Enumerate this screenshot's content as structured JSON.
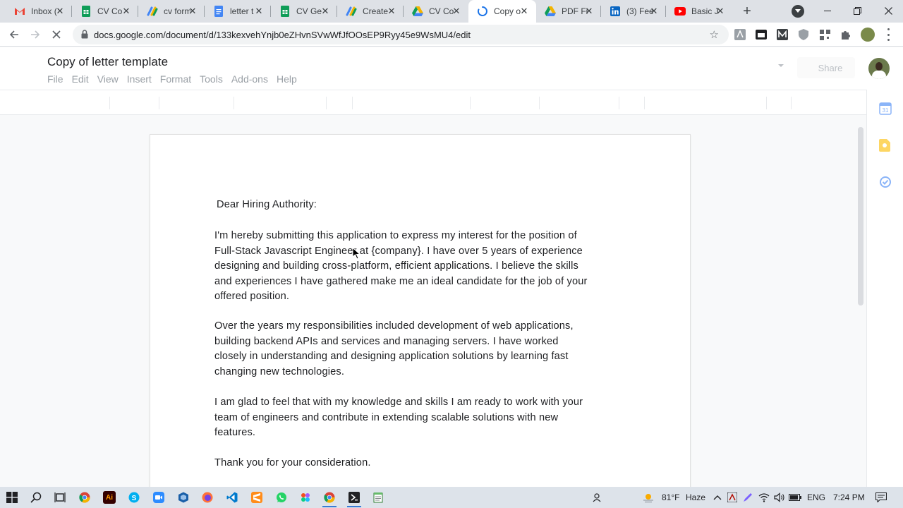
{
  "browser": {
    "tabs": [
      {
        "title": "Inbox (",
        "icon": "gmail-icon",
        "color": "#ea4335"
      },
      {
        "title": "CV Co",
        "icon": "sheets-icon",
        "color": "#0f9d58"
      },
      {
        "title": "cv form",
        "icon": "apps-script-icon",
        "color": "#f4b400"
      },
      {
        "title": "letter t",
        "icon": "docs-icon",
        "color": "#4285f4"
      },
      {
        "title": "CV Ge",
        "icon": "sheets-icon",
        "color": "#0f9d58"
      },
      {
        "title": "Create",
        "icon": "apps-script-icon",
        "color": "#f4b400"
      },
      {
        "title": "CV Co",
        "icon": "drive-icon",
        "color": "#1fa463"
      },
      {
        "title": "Copy o",
        "icon": "loading-spinner-icon",
        "color": "#1a73e8",
        "active": true
      },
      {
        "title": "PDF Fil",
        "icon": "drive-icon",
        "color": "#1fa463"
      },
      {
        "title": "(3) Fee",
        "icon": "linkedin-icon",
        "color": "#0a66c2"
      },
      {
        "title": "Basic J",
        "icon": "youtube-icon",
        "color": "#ff0000"
      }
    ],
    "url": "docs.google.com/document/d/133kexvehYnjb0eZHvnSVwWfJfOOsEP9Ryy45e9WsMU4/edit"
  },
  "doc": {
    "title": "Copy of letter template",
    "menu": [
      "File",
      "Edit",
      "View",
      "Insert",
      "Format",
      "Tools",
      "Add-ons",
      "Help"
    ],
    "share_label": "Share",
    "salutation": "Dear Hiring Authority:",
    "para1": [
      "I'm hereby submitting this application to express my interest for the position of",
      "Full-Stack Javascript Engineer at {company}. I have over 5 years of experience",
      "designing and building cross-platform, efficient applications. I believe the skills",
      "and experiences I have gathered make me an ideal candidate for the job of your",
      "offered position."
    ],
    "para2": [
      "Over the years my responsibilities included development of web applications,",
      "building backend APIs and services and managing servers. I have worked",
      "closely in understanding and designing application solutions by learning fast",
      "changing new technologies."
    ],
    "para3": [
      "I am glad to feel that with my knowledge and skills I am ready to work with your",
      "team of engineers and contribute in extending scalable solutions with new",
      "features."
    ],
    "closing": "Thank you for your consideration."
  },
  "taskbar": {
    "weather": "81°F",
    "condition": "Haze",
    "lang": "ENG",
    "time": "7:24 PM"
  },
  "colors": {
    "accent": "#1a73e8",
    "tabstrip": "#dee1e6"
  }
}
